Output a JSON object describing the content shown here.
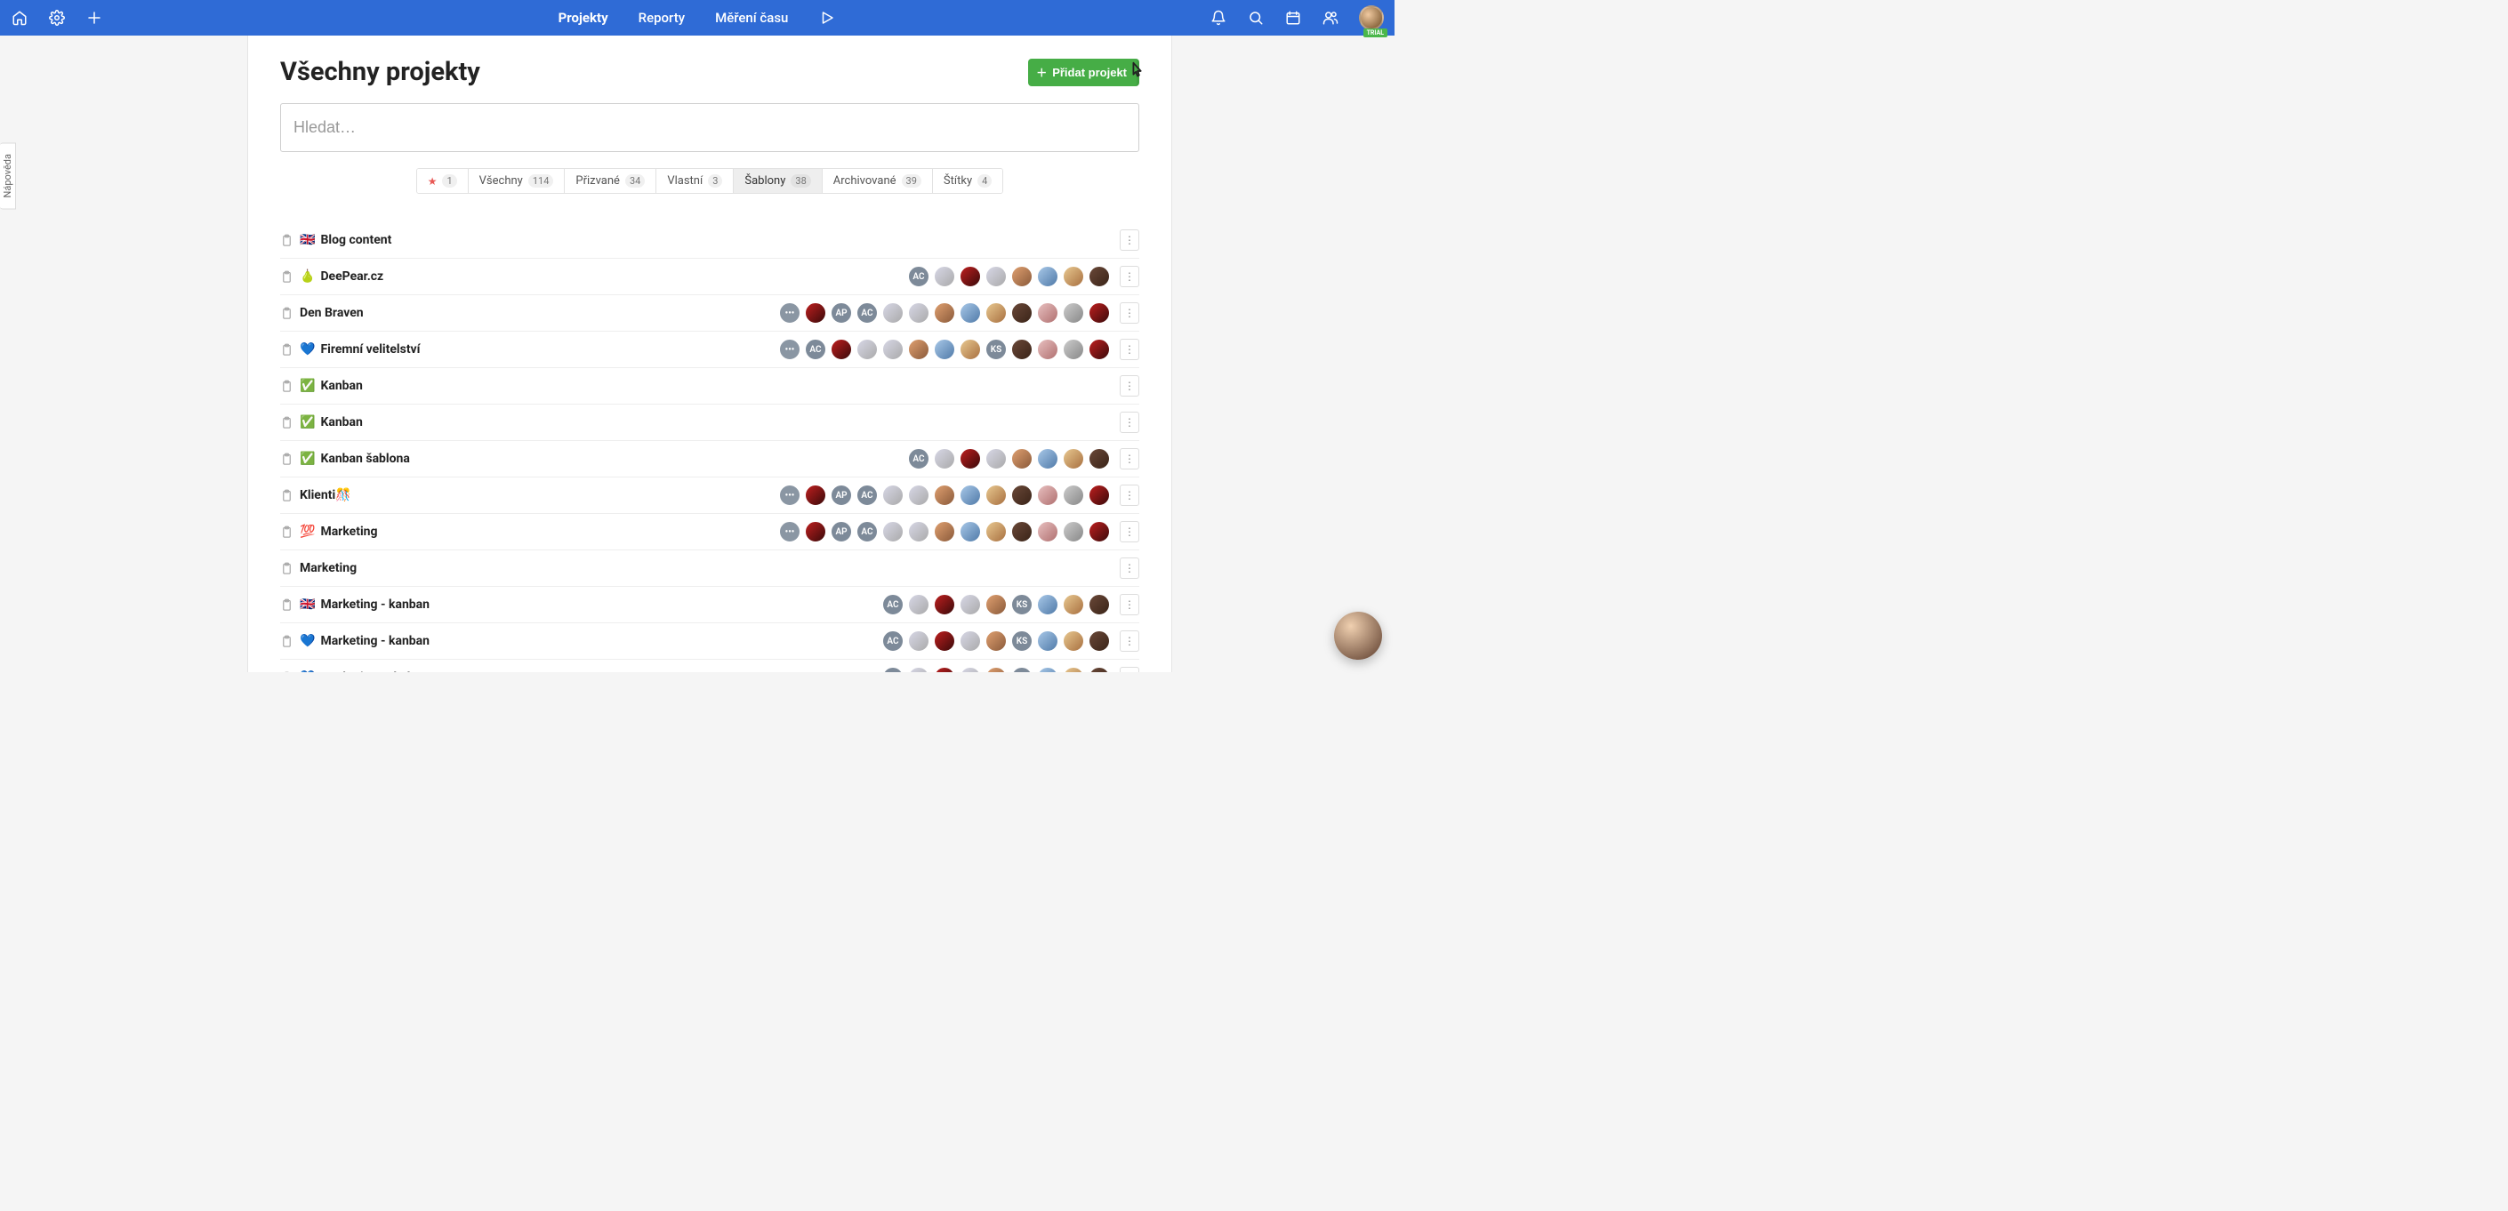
{
  "header": {
    "nav": {
      "projects": "Projekty",
      "reports": "Reporty",
      "time": "Měření času"
    },
    "trial": "TRIAL"
  },
  "help_tab": "Nápověda",
  "page": {
    "title": "Všechny projekty",
    "add_button": "Přidat projekt",
    "search_placeholder": "Hledat…"
  },
  "filters": {
    "starred": {
      "count": "1"
    },
    "all": {
      "label": "Všechny",
      "count": "114"
    },
    "invited": {
      "label": "Přizvané",
      "count": "34"
    },
    "own": {
      "label": "Vlastní",
      "count": "3"
    },
    "templates": {
      "label": "Šablony",
      "count": "38"
    },
    "archived": {
      "label": "Archivované",
      "count": "39"
    },
    "labels": {
      "label": "Štítky",
      "count": "4"
    }
  },
  "projects": [
    {
      "emoji": "🇬🇧",
      "name": "Blog content",
      "members": []
    },
    {
      "emoji": "🍐",
      "name": "DeePear.cz",
      "members": [
        "AC",
        "logo",
        "p",
        "p",
        "p",
        "p",
        "p",
        "p"
      ]
    },
    {
      "emoji": "",
      "name": "Den Braven",
      "members": [
        "more",
        "p",
        "AP",
        "AC",
        "p",
        "logo",
        "p",
        "p",
        "p",
        "p",
        "p",
        "p",
        "p"
      ]
    },
    {
      "emoji": "💙",
      "name": "Firemní velitelství",
      "members": [
        "more",
        "AC",
        "p",
        "logo",
        "p",
        "p",
        "p",
        "p",
        "KS",
        "p",
        "p",
        "p",
        "p"
      ]
    },
    {
      "emoji": "✅",
      "name": "Kanban",
      "members": []
    },
    {
      "emoji": "✅",
      "name": "Kanban",
      "members": []
    },
    {
      "emoji": "✅",
      "name": "Kanban šablona",
      "members": [
        "AC",
        "logo",
        "p",
        "p",
        "p",
        "p",
        "p",
        "p"
      ]
    },
    {
      "emoji": "",
      "name": "Klienti🎊",
      "members": [
        "more",
        "p",
        "AP",
        "AC",
        "p",
        "logo",
        "p",
        "p",
        "p",
        "p",
        "p",
        "p",
        "p"
      ]
    },
    {
      "emoji": "💯",
      "name": "Marketing",
      "members": [
        "more",
        "p",
        "AP",
        "AC",
        "p",
        "logo",
        "p",
        "p",
        "p",
        "p",
        "p",
        "p",
        "p"
      ]
    },
    {
      "emoji": "",
      "name": "Marketing",
      "members": []
    },
    {
      "emoji": "🇬🇧",
      "name": "Marketing - kanban",
      "members": [
        "AC",
        "logo",
        "p",
        "p",
        "p",
        "KS",
        "p",
        "p",
        "p"
      ]
    },
    {
      "emoji": "💙",
      "name": "Marketing - kanban",
      "members": [
        "AC",
        "logo",
        "p",
        "p",
        "p",
        "KS",
        "p",
        "p",
        "p"
      ]
    },
    {
      "emoji": "💙",
      "name": "Marketingový tým",
      "members": [
        "AC",
        "logo",
        "p",
        "p",
        "p",
        "KS",
        "p",
        "p",
        "p"
      ]
    }
  ]
}
